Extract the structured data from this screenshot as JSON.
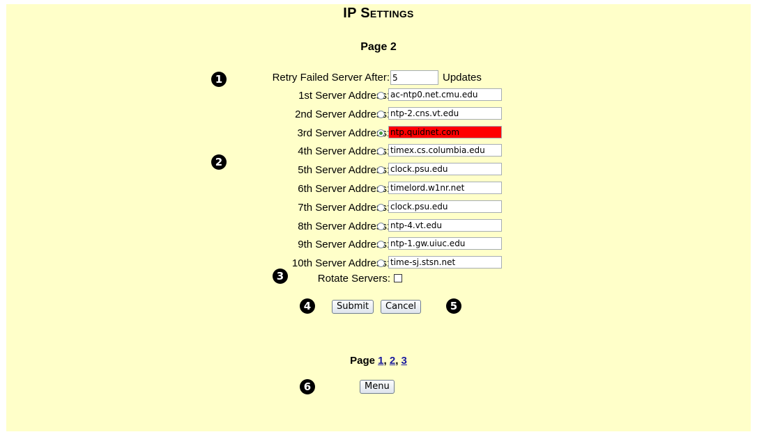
{
  "header": {
    "title": "IP Settings",
    "subtitle": "Page 2"
  },
  "callouts": [
    "1",
    "2",
    "3",
    "4",
    "5",
    "6"
  ],
  "retry": {
    "label": "Retry Failed Server After:",
    "value": "5",
    "unit": "Updates"
  },
  "servers": [
    {
      "label": "1st Server Address:",
      "value": "ac-ntp0.net.cmu.edu"
    },
    {
      "label": "2nd Server Address:",
      "value": "ntp-2.cns.vt.edu"
    },
    {
      "label": "3rd Server Address:",
      "value": "ntp.quidnet.com"
    },
    {
      "label": "4th Server Address:",
      "value": "timex.cs.columbia.edu"
    },
    {
      "label": "5th Server Address:",
      "value": "clock.psu.edu"
    },
    {
      "label": "6th Server Address:",
      "value": "timelord.w1nr.net"
    },
    {
      "label": "7th Server Address:",
      "value": "clock.psu.edu"
    },
    {
      "label": "8th Server Address:",
      "value": "ntp-4.vt.edu"
    },
    {
      "label": "9th Server Address:",
      "value": "ntp-1.gw.uiuc.edu"
    },
    {
      "label": "10th Server Address:",
      "value": "time-sj.stsn.net"
    }
  ],
  "selected_server": "3rd Server Address:",
  "highlight_color": "#ff0000",
  "rotate": {
    "label": "Rotate Servers:"
  },
  "buttons": {
    "submit": "Submit",
    "cancel": "Cancel",
    "menu": "Menu"
  },
  "pagination": {
    "label": "Page",
    "links": [
      "1",
      "2",
      "3"
    ],
    "separators": [
      ",",
      ","
    ]
  },
  "colors": {
    "background": "#ffffc9",
    "link": "#1a1a9e"
  }
}
